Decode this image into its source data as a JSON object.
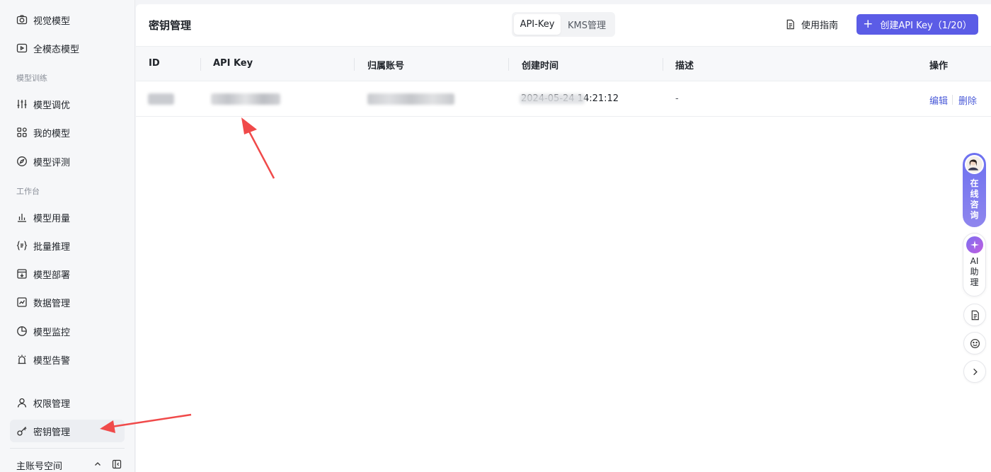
{
  "sidebar": {
    "items_top": [
      {
        "label": "视觉模型",
        "icon": "camera-icon"
      },
      {
        "label": "全模态模型",
        "icon": "video-icon"
      }
    ],
    "section_training": "模型训练",
    "items_training": [
      {
        "label": "模型调优",
        "icon": "sliders-icon"
      },
      {
        "label": "我的模型",
        "icon": "grid-icon"
      },
      {
        "label": "模型评测",
        "icon": "compass-icon"
      }
    ],
    "section_workbench": "工作台",
    "items_workbench": [
      {
        "label": "模型用量",
        "icon": "bar-chart-icon"
      },
      {
        "label": "批量推理",
        "icon": "braces-list-icon"
      },
      {
        "label": "模型部署",
        "icon": "deploy-box-icon"
      },
      {
        "label": "数据管理",
        "icon": "line-chart-icon"
      },
      {
        "label": "模型监控",
        "icon": "pie-chart-icon"
      },
      {
        "label": "模型告警",
        "icon": "alarm-icon"
      }
    ],
    "items_bottom": [
      {
        "label": "权限管理",
        "icon": "user-icon"
      },
      {
        "label": "密钥管理",
        "icon": "key-icon",
        "active": true
      }
    ],
    "account_space": "主账号空间"
  },
  "header": {
    "title": "密钥管理",
    "tabs": [
      {
        "label": "API-Key",
        "active": true
      },
      {
        "label": "KMS管理",
        "active": false
      }
    ],
    "guide_label": "使用指南",
    "create_button": "创建API Key（1/20）"
  },
  "table": {
    "columns": [
      "ID",
      "API Key",
      "归属账号",
      "创建时间",
      "描述",
      "操作"
    ],
    "rows": [
      {
        "id": "",
        "api_key": "",
        "account": "",
        "created_visible": "2024-05-24 14:21:12",
        "description": "-",
        "actions": [
          "编辑",
          "删除"
        ]
      }
    ]
  },
  "float_widgets": {
    "consult": "在线咨询",
    "assistant": "AI助理"
  },
  "colors": {
    "accent": "#5b5ce6",
    "link": "#4b5bd8",
    "annotation_arrow": "#f04a4a"
  }
}
